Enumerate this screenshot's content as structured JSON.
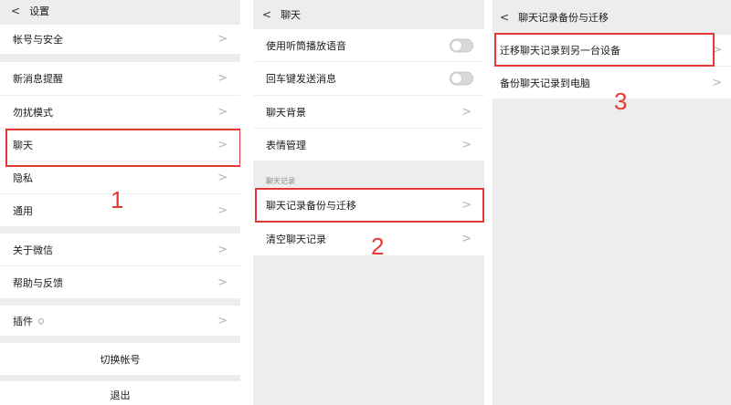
{
  "panel1": {
    "nav_title": "设置",
    "back_glyph": "<",
    "items": [
      {
        "label": "帐号与安全"
      },
      {
        "label": "新消息提醒"
      },
      {
        "label": "勿扰模式"
      },
      {
        "label": "聊天"
      },
      {
        "label": "隐私"
      },
      {
        "label": "通用"
      },
      {
        "label": "关于微信"
      },
      {
        "label": "帮助与反馈"
      },
      {
        "label": "插件"
      }
    ],
    "switch_account": "切换帐号",
    "logout": "退出",
    "step": "1"
  },
  "panel2": {
    "nav_title": "聊天",
    "back_glyph": "<",
    "toggles": [
      {
        "label": "使用听筒播放语音",
        "on": false
      },
      {
        "label": "回车键发送消息",
        "on": false
      }
    ],
    "items": [
      {
        "label": "聊天背景"
      },
      {
        "label": "表情管理"
      }
    ],
    "section_label": "聊天记录",
    "history_items": [
      {
        "label": "聊天记录备份与迁移"
      },
      {
        "label": "清空聊天记录"
      }
    ],
    "step": "2"
  },
  "panel3": {
    "nav_title": "聊天记录备份与迁移",
    "back_glyph": "<",
    "items": [
      {
        "label": "迁移聊天记录到另一台设备"
      },
      {
        "label": "备份聊天记录到电脑"
      }
    ],
    "step": "3"
  },
  "chevron_glyph": ">",
  "colors": {
    "highlight": "#e53935",
    "background": "#ededed",
    "item": "#ffffff"
  }
}
